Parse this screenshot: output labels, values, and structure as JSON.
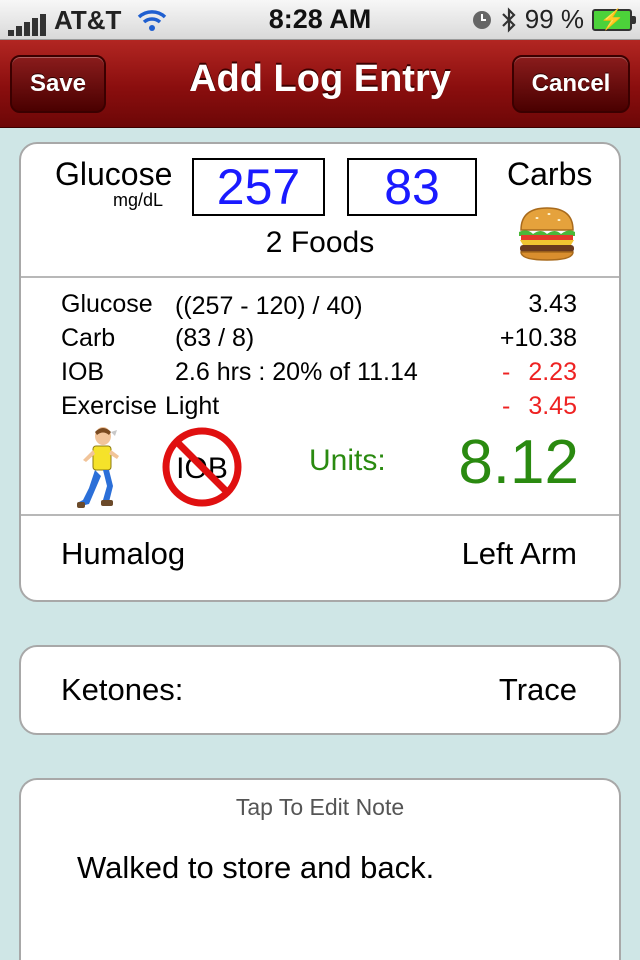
{
  "status_bar": {
    "carrier": "AT&T",
    "time": "8:28 AM",
    "battery": "99 %"
  },
  "nav": {
    "title": "Add Log Entry",
    "save_label": "Save",
    "cancel_label": "Cancel"
  },
  "entry": {
    "glucose_label": "Glucose",
    "glucose_unit": "mg/dL",
    "glucose_value": "257",
    "carbs_value": "83",
    "carbs_label": "Carbs",
    "foods": "2 Foods"
  },
  "calculation": [
    {
      "label": "Glucose",
      "formula": "((257 - 120) / 40)",
      "sign": "",
      "value": "3.43"
    },
    {
      "label": "Carb",
      "formula": "(83 / 8)",
      "sign": "+",
      "value": "10.38"
    },
    {
      "label": "IOB",
      "formula": "2.6 hrs : 20% of 11.14",
      "sign": "-",
      "value": "2.23"
    },
    {
      "label": "Exercise",
      "formula": "Light",
      "sign": "-",
      "value": "3.45"
    }
  ],
  "units": {
    "label": "Units:",
    "value": "8.12"
  },
  "iob_icon_text": "IOB",
  "insulin": {
    "type": "Humalog",
    "site": "Left Arm"
  },
  "ketones": {
    "label": "Ketones:",
    "value": "Trace"
  },
  "note": {
    "hint": "Tap To Edit Note",
    "text": "Walked to store and back."
  },
  "colors": {
    "nav_red": "#8a0e0e",
    "value_blue": "#1a1aff",
    "units_green": "#2a8a10",
    "negative_red": "#e22222",
    "background": "#cfe6e6"
  }
}
